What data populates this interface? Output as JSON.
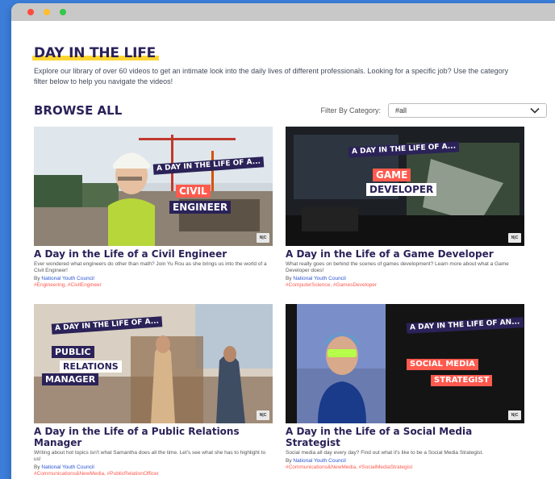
{
  "header": {
    "title": "DAY IN THE LIFE",
    "intro": "Explore our library of over 60 videos to get an intimate look into the daily lives of different professionals. Looking for a specific job? Use the category filter below to help you navigate the videos!"
  },
  "browse": {
    "title": "BROWSE ALL",
    "filter_label": "Filter By Category:",
    "filter_value": "#all"
  },
  "cards": [
    {
      "title": "A Day in the Life of a Civil Engineer",
      "desc": "Ever wondered what engineers do other than math? Join Yu Rou as she brings us into the world of a Civil Engineer!",
      "by_prefix": "By ",
      "org": "National Youth Council",
      "tags": "#Engineering, #CivilEngineer",
      "banner_top": "A DAY IN THE LIFE OF A...",
      "banner_main1": "CIVIL",
      "banner_main2": "ENGINEER",
      "badge": "N|C"
    },
    {
      "title": "A Day in the Life of a Game Developer",
      "desc": "What really goes on behind the scenes of games development? Learn more about what a Game Developer does!",
      "by_prefix": "By ",
      "org": "National Youth Council",
      "tags": "#ComputerScience, #GamesDeveloper",
      "banner_top": "A DAY IN THE LIFE OF A...",
      "banner_main1": "GAME",
      "banner_main2": "DEVELOPER",
      "badge": "N|C"
    },
    {
      "title": "A Day in the Life of a Public Relations Manager",
      "desc": "Writing about hot topics isn't what Samantha does all the time. Let's see what she has to highlight to us!",
      "by_prefix": "By ",
      "org": "National Youth Council",
      "tags": "#Communications&NewMedia, #PublicRelationOfficer",
      "banner_top": "A DAY IN THE LIFE OF A...",
      "banner_main1": "PUBLIC",
      "banner_main2": "RELATIONS",
      "banner_main3": "MANAGER",
      "badge": "N|C"
    },
    {
      "title": "A Day in the Life of a Social Media Strategist",
      "desc": "Social media all day every day? Find out what it's like to be a Social Media Strategist.",
      "by_prefix": "By ",
      "org": "National Youth Council",
      "tags": "#Communications&NewMedia, #SocialMediaStrategist",
      "banner_top": "A DAY IN THE LIFE OF AN...",
      "banner_main1": "SOCIAL MEDIA",
      "banner_main2": "STRATEGIST",
      "badge": "N|C"
    }
  ],
  "icons": {
    "filter_chevron": "chevron-down-icon"
  },
  "colors": {
    "navy": "#2a2258",
    "accent_yellow": "#ffd633",
    "tag_red": "#ff5a4e",
    "link_blue": "#2a55d0",
    "page_bg": "#3b7dd8"
  }
}
